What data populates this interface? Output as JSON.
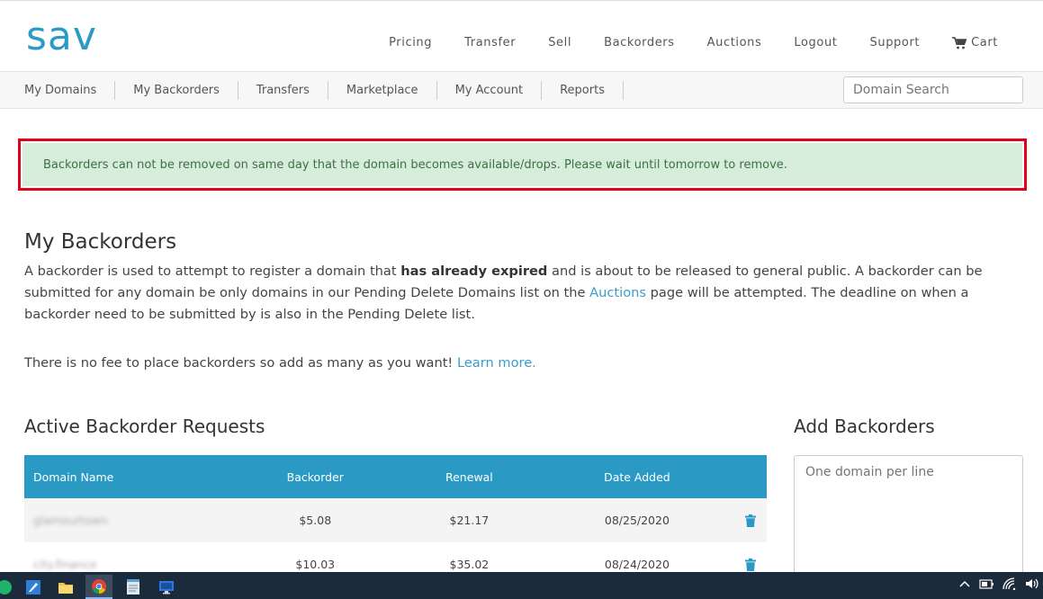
{
  "header": {
    "logo": "sav",
    "nav": [
      "Pricing",
      "Transfer",
      "Sell",
      "Backorders",
      "Auctions",
      "Logout",
      "Support"
    ],
    "cart_label": "Cart"
  },
  "subnav": {
    "items": [
      "My Domains",
      "My Backorders",
      "Transfers",
      "Marketplace",
      "My Account",
      "Reports"
    ],
    "search_placeholder": "Domain Search"
  },
  "alert": {
    "text": "Backorders can not be removed on same day that the domain becomes available/drops. Please wait until tomorrow to remove."
  },
  "page": {
    "title": "My Backorders",
    "intro_1": "A backorder is used to attempt to register a domain that ",
    "intro_bold": "has already expired",
    "intro_2": " and is about to be released to general public. A backorder can be submitted for any domain be only domains in our Pending Delete Domains list on the ",
    "intro_link": "Auctions",
    "intro_3": " page will be attempted. The deadline on when a backorder need to be submitted by is also in the Pending Delete list.",
    "fee_text": "There is no fee to place backorders so add as many as you want! ",
    "fee_link": "Learn more."
  },
  "active": {
    "title": "Active Backorder Requests",
    "columns": [
      "Domain Name",
      "Backorder",
      "Renewal",
      "Date Added"
    ],
    "rows": [
      {
        "domain": "glamourtown",
        "backorder": "$5.08",
        "renewal": "$21.17",
        "date": "08/25/2020"
      },
      {
        "domain": "city.finance",
        "backorder": "$10.03",
        "renewal": "$35.02",
        "date": "08/24/2020"
      }
    ]
  },
  "add": {
    "title": "Add Backorders",
    "placeholder": "One domain per line"
  },
  "colors": {
    "brand": "#2a9bc5",
    "alert_bg": "#d6eddb",
    "alert_border": "#e0001a",
    "taskbar": "#1c2b3c"
  },
  "icons": [
    "shopping-cart-icon",
    "trash-icon",
    "chrome-icon",
    "file-explorer-icon",
    "notepad-icon",
    "remote-desktop-icon",
    "wifi-icon",
    "volume-icon"
  ]
}
